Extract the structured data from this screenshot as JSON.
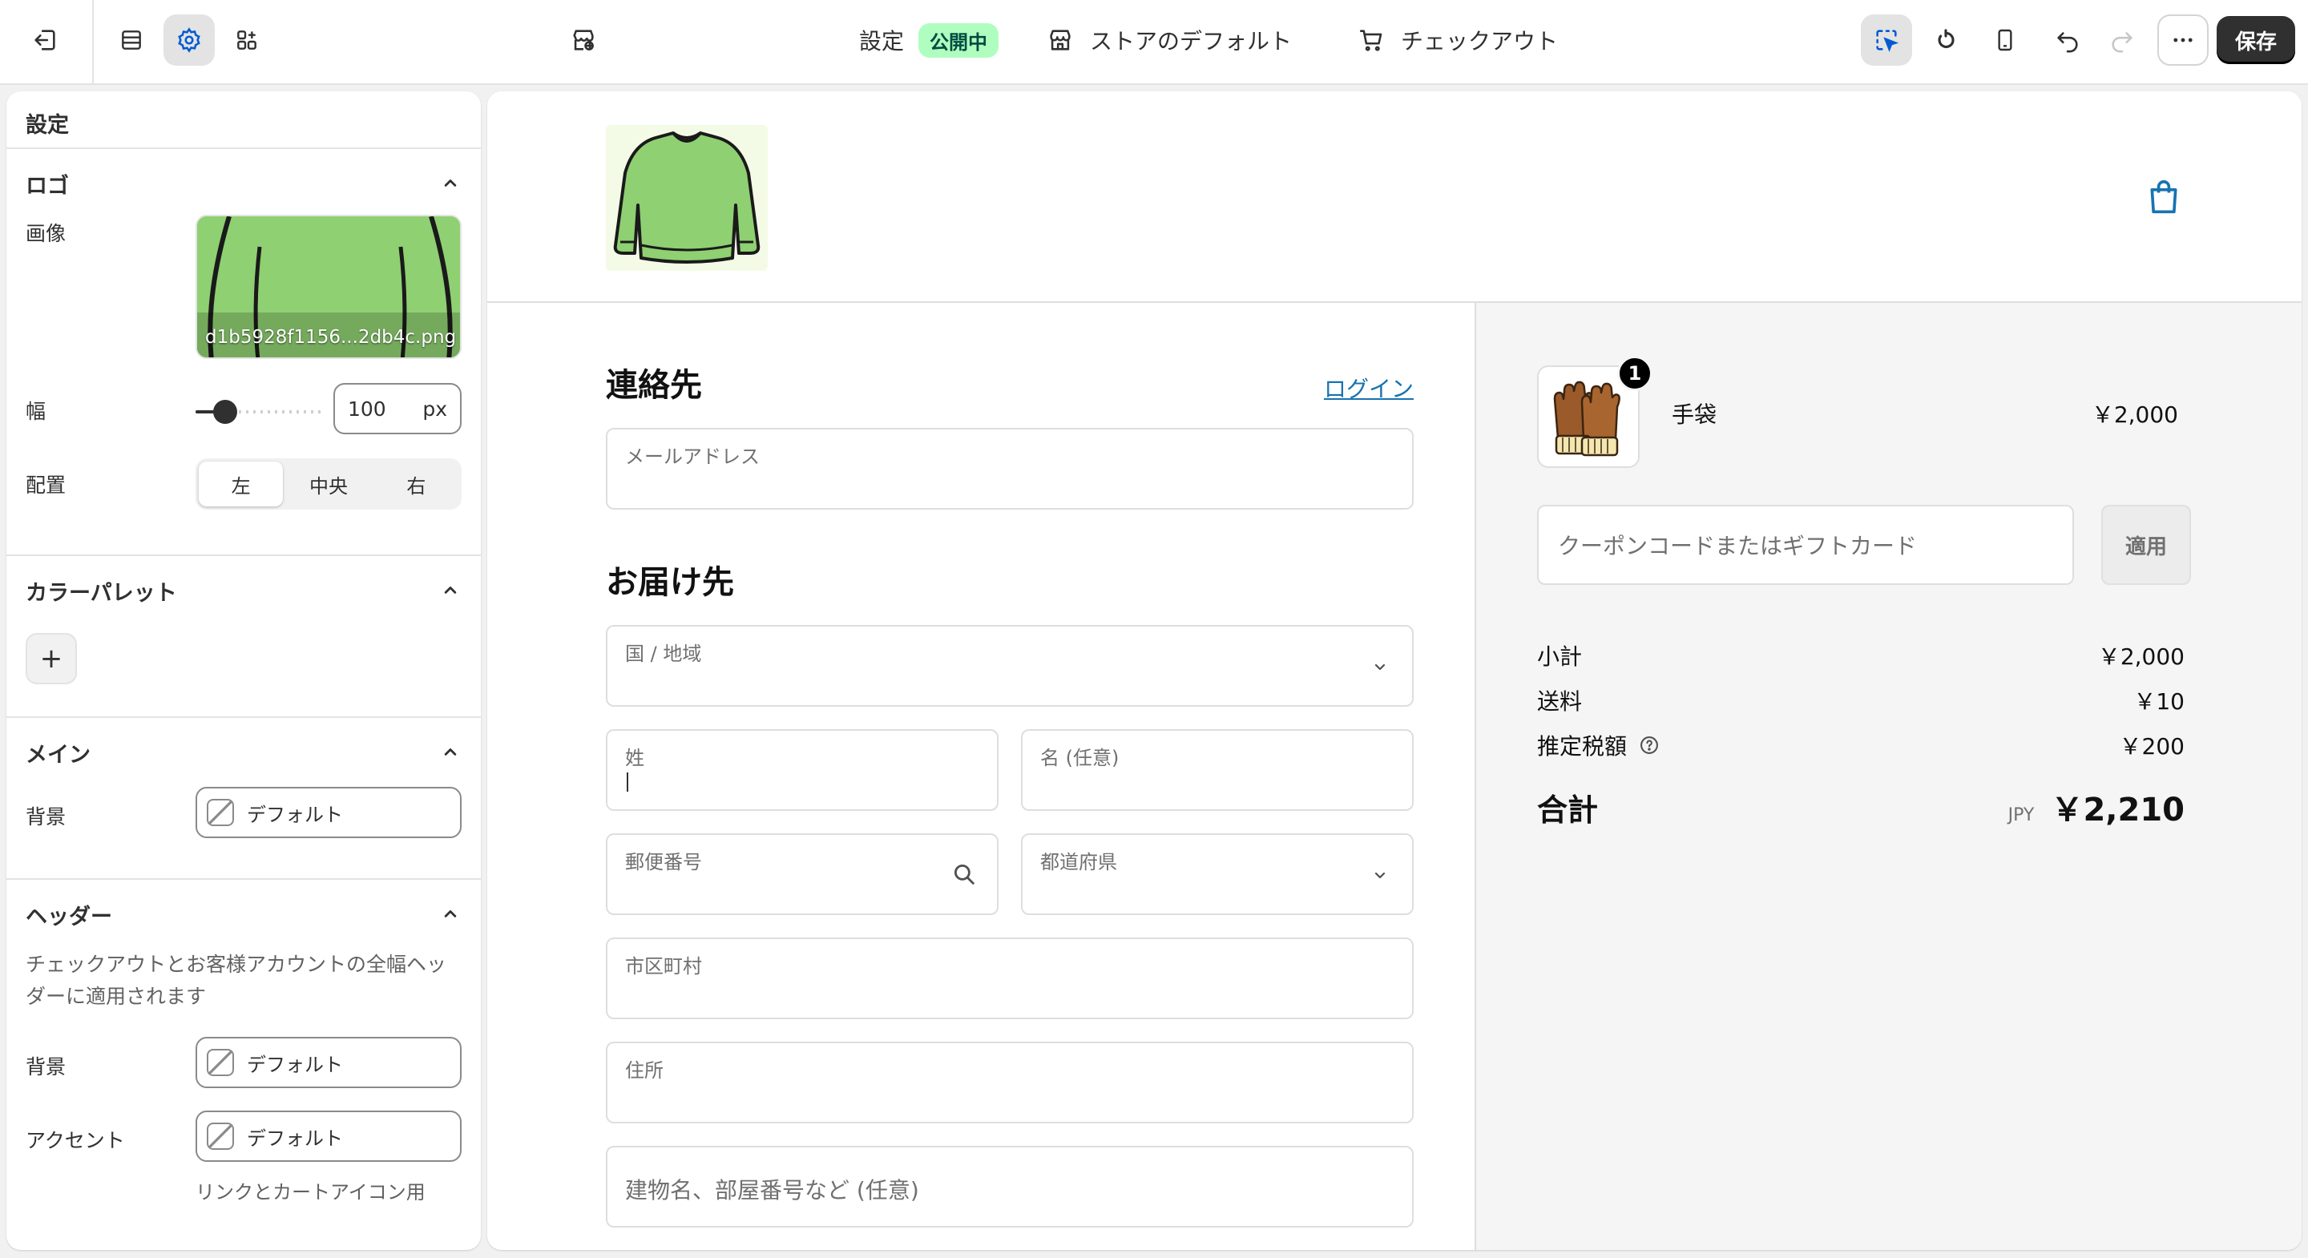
{
  "topbar": {
    "settings_label": "設定",
    "status_badge": "公開中",
    "store_default_label": "ストアのデフォルト",
    "checkout_label": "チェックアウト",
    "save_label": "保存"
  },
  "panel": {
    "title": "設定",
    "logo": {
      "heading": "ロゴ",
      "image_label": "画像",
      "filename": "d1b5928f1156...2db4c.png",
      "width_label": "幅",
      "width_value": "100",
      "width_unit": "px",
      "width_value_ratio": 0.25,
      "align_label": "配置",
      "align_options": [
        "左",
        "中央",
        "右"
      ],
      "align_selected": "左"
    },
    "palette": {
      "heading": "カラーパレット",
      "add_label": "+"
    },
    "main": {
      "heading": "メイン",
      "bg_label": "背景",
      "bg_value": "デフォルト"
    },
    "header": {
      "heading": "ヘッダー",
      "description": "チェックアウトとお客様アカウントの全幅ヘッダーに適用されます",
      "bg_label": "背景",
      "bg_value": "デフォルト",
      "accent_label": "アクセント",
      "accent_value": "デフォルト",
      "accent_help": "リンクとカートアイコン用"
    }
  },
  "checkout": {
    "contact_heading": "連絡先",
    "login_link": "ログイン",
    "email_placeholder": "メールアドレス",
    "delivery_heading": "お届け先",
    "country_label": "国 / 地域",
    "last_name_label": "姓",
    "first_name_label": "名 (任意)",
    "postal_label": "郵便番号",
    "prefecture_label": "都道府県",
    "city_label": "市区町村",
    "address_label": "住所",
    "building_placeholder": "建物名、部屋番号など (任意)"
  },
  "summary": {
    "item_name": "手袋",
    "item_qty": "1",
    "item_price": "￥2,000",
    "coupon_placeholder": "クーポンコードまたはギフトカード",
    "apply_label": "適用",
    "subtotal_label": "小計",
    "subtotal_value": "￥2,000",
    "shipping_label": "送料",
    "shipping_value": "￥10",
    "tax_label": "推定税額",
    "tax_value": "￥200",
    "total_label": "合計",
    "total_currency": "JPY",
    "total_value": "￥2,210"
  },
  "colors": {
    "accent_link": "#1773b0",
    "active_tool": "#005bd3",
    "badge_bg": "#affebf",
    "sweater": "#8fd072",
    "gloves": "#9a5a2a"
  },
  "icons": {
    "exit": "exit-icon",
    "sections": "sections-icon",
    "settings": "gear-icon",
    "apps": "apps-icon",
    "locale": "globe-store-icon",
    "store": "store-icon",
    "cart": "cart-icon",
    "inspector": "inspector-icon",
    "refresh": "refresh-icon",
    "mobile": "mobile-icon",
    "undo": "undo-icon",
    "redo": "redo-icon",
    "more": "more-icon",
    "bag": "shopping-bag-icon",
    "chevron_up": "chevron-up-icon",
    "chevron_down": "chevron-down-icon",
    "search": "search-icon",
    "help": "help-icon"
  }
}
